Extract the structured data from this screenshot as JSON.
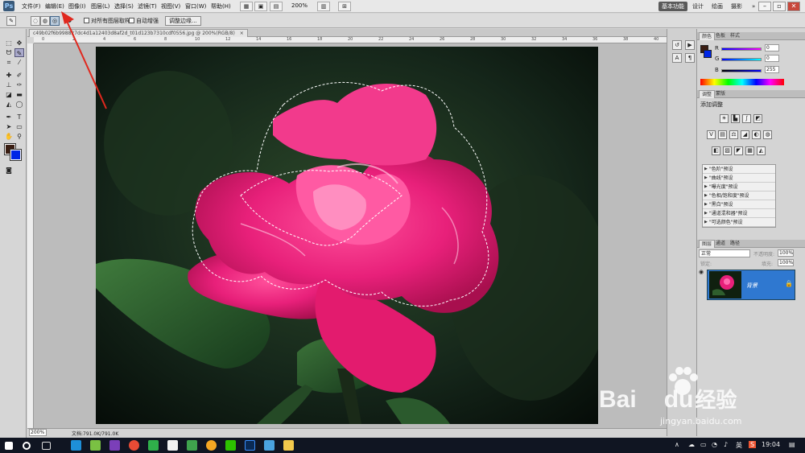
{
  "app": {
    "logo": "Ps",
    "menus": [
      "文件(F)",
      "编辑(E)",
      "图像(I)",
      "图层(L)",
      "选择(S)",
      "滤镜(T)",
      "视图(V)",
      "窗口(W)",
      "帮助(H)"
    ],
    "zoom": "200%",
    "workspaces": [
      "基本功能",
      "设计",
      "绘画",
      "摄影"
    ],
    "workspace_more": "»"
  },
  "options": {
    "sample_all_layers": "对所有图层取样",
    "auto_enhance": "自动增强",
    "refine_edge": "调整边缘..."
  },
  "document": {
    "tab_title": "c49b02f6b998827dc4d1a12403d8af2d_t01d123b7310cdf0556.jpg @ 200%(RGB/8)",
    "tab_close": "×",
    "ruler_labels": [
      "0",
      "2",
      "4",
      "6",
      "8",
      "10",
      "12",
      "14",
      "16",
      "18",
      "20",
      "22",
      "24",
      "26",
      "28",
      "30",
      "32",
      "34",
      "36",
      "38",
      "40"
    ],
    "status_zoom": "200%",
    "status_doc": "文档:791.0K/791.0K"
  },
  "color_panel": {
    "tabs": [
      "颜色",
      "色板",
      "样式"
    ],
    "r_label": "R",
    "g_label": "G",
    "b_label": "B",
    "r_value": "0",
    "g_value": "0",
    "b_value": "255"
  },
  "adjust_panel": {
    "tabs": [
      "调整",
      "蒙版"
    ],
    "title": "添加调整",
    "presets": [
      "\"色阶\"预设",
      "\"曲线\"预设",
      "\"曝光度\"预设",
      "\"色相/饱和度\"预设",
      "\"黑白\"预设",
      "\"通道混和器\"预设",
      "\"可选颜色\"预设"
    ]
  },
  "layers_panel": {
    "tabs": [
      "图层",
      "通道",
      "路径"
    ],
    "blend_mode": "正常",
    "opacity_label": "不透明度:",
    "opacity_value": "100%",
    "lock_label": "锁定:",
    "fill_label": "填充:",
    "fill_value": "100%",
    "layer_name": "背景"
  },
  "watermark": {
    "brand_a": "Bai",
    "brand_b": "du",
    "brand_cn": "经验",
    "url": "jingyan.baidu.com"
  },
  "taskbar": {
    "ime": "英",
    "time": "19:04"
  },
  "colors": {
    "foreground": "#3a1d12",
    "background": "#0026e6",
    "selected_layer": "#2f78d0",
    "arrow": "#e0281e"
  }
}
